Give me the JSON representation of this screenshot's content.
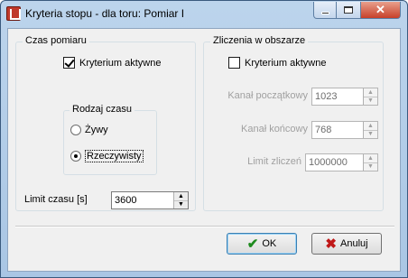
{
  "window": {
    "title": "Kryteria stopu - dla toru: Pomiar I",
    "icon": "app-icon",
    "controls": {
      "minimize": "minimize-icon",
      "maximize": "maximize-icon",
      "close": "✕"
    }
  },
  "measurement_time": {
    "group_title": "Czas pomiaru",
    "criterion_label": "Kryterium aktywne",
    "criterion_checked": true,
    "time_type": {
      "group_title": "Rodzaj czasu",
      "options": [
        "Żywy",
        "Rzeczywisty"
      ],
      "selected": "Rzeczywisty"
    },
    "limit_label": "Limit czasu [s]",
    "limit_value": "3600"
  },
  "area_counts": {
    "group_title": "Zliczenia w obszarze",
    "criterion_label": "Kryterium aktywne",
    "criterion_checked": false,
    "start_channel_label": "Kanał początkowy",
    "start_channel_value": "1023",
    "end_channel_label": "Kanał końcowy",
    "end_channel_value": "768",
    "count_limit_label": "Limit zliczeń",
    "count_limit_value": "1000000"
  },
  "buttons": {
    "ok_label": "OK",
    "cancel_label": "Anuluj"
  },
  "colors": {
    "ok_icon": "#1d8a1d",
    "cancel_icon": "#c01818"
  }
}
